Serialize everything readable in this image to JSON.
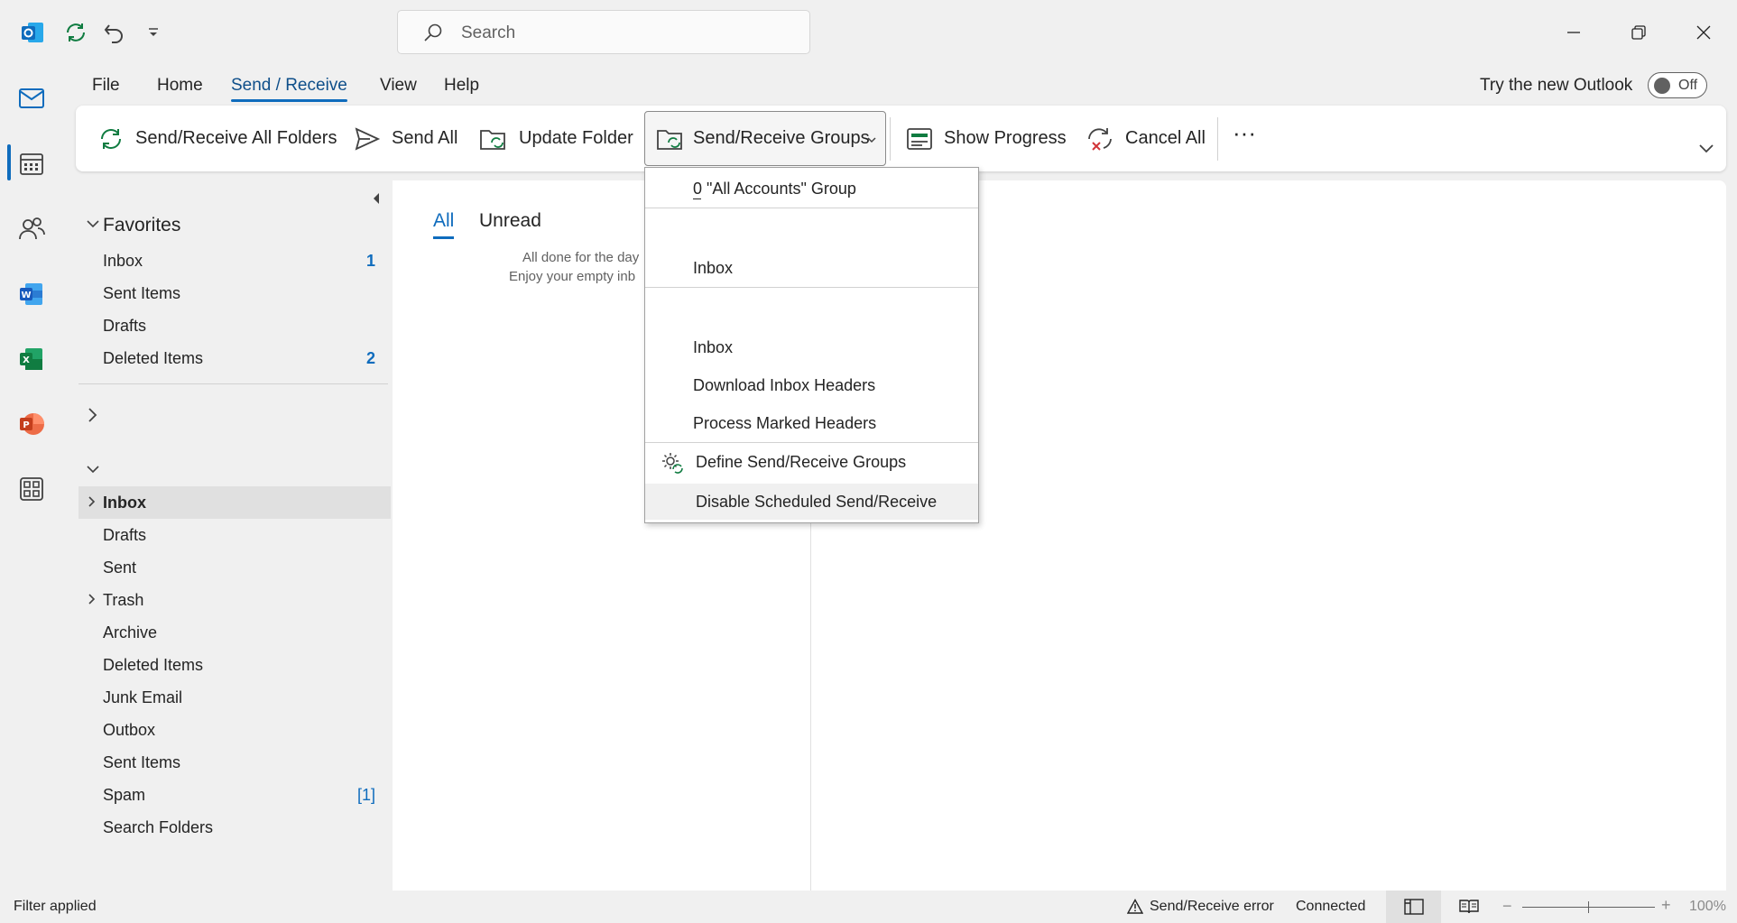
{
  "titlebar": {
    "search_placeholder": "Search",
    "icons": [
      "outlook-logo-icon",
      "sync-icon",
      "undo-icon",
      "customize-quick-access-icon"
    ],
    "window_controls": [
      "minimize-icon",
      "restore-icon",
      "close-icon"
    ]
  },
  "app_rail": {
    "items": [
      "mail-icon",
      "calendar-icon",
      "people-icon",
      "word-icon",
      "excel-icon",
      "powerpoint-icon",
      "apps-icon"
    ]
  },
  "ribbon_tabs": [
    {
      "label": "File"
    },
    {
      "label": "Home"
    },
    {
      "label": "Send / Receive",
      "active": true
    },
    {
      "label": "View"
    },
    {
      "label": "Help"
    }
  ],
  "new_outlook": {
    "label": "Try the new Outlook",
    "toggle_state": "Off"
  },
  "ribbon": {
    "send_receive_all": "Send/Receive All Folders",
    "send_all": "Send All",
    "update_folder": "Update Folder",
    "send_receive_groups": "Send/Receive Groups",
    "show_progress": "Show Progress",
    "cancel_all": "Cancel All",
    "more": "···"
  },
  "dropdown": {
    "items": [
      {
        "label": "0 \"All Accounts\" Group"
      },
      {
        "label": ""
      },
      {
        "label": "Inbox"
      },
      {
        "label": ""
      },
      {
        "label": "Inbox"
      },
      {
        "label": "Download Inbox Headers"
      },
      {
        "label": "Process Marked Headers"
      },
      {
        "label": "Define Send/Receive Groups"
      },
      {
        "label": "Disable Scheduled Send/Receive"
      }
    ]
  },
  "favorites": {
    "title": "Favorites",
    "items": [
      {
        "label": "Inbox",
        "count": "1"
      },
      {
        "label": "Sent Items",
        "count": ""
      },
      {
        "label": "Drafts",
        "count": ""
      },
      {
        "label": "Deleted Items",
        "count": "2"
      }
    ]
  },
  "account_folders": [
    {
      "label": "Inbox",
      "count": ""
    },
    {
      "label": "Drafts",
      "count": ""
    },
    {
      "label": "Sent",
      "count": ""
    },
    {
      "label": "Trash",
      "count": ""
    },
    {
      "label": "Archive",
      "count": ""
    },
    {
      "label": "Deleted Items",
      "count": ""
    },
    {
      "label": "Junk Email",
      "count": ""
    },
    {
      "label": "Outbox",
      "count": ""
    },
    {
      "label": "Sent Items",
      "count": ""
    },
    {
      "label": "Spam",
      "count": "[1]"
    },
    {
      "label": "Search Folders",
      "count": ""
    }
  ],
  "message_list": {
    "tabs": [
      "All",
      "Unread"
    ],
    "empty_line1": "All done for the day",
    "empty_line2": "Enjoy your empty inb"
  },
  "statusbar": {
    "filter": "Filter applied",
    "error": "Send/Receive error",
    "connection": "Connected",
    "zoom": "100%"
  },
  "colors": {
    "accent": "#0f6cbd",
    "background": "#f0f0f0"
  }
}
